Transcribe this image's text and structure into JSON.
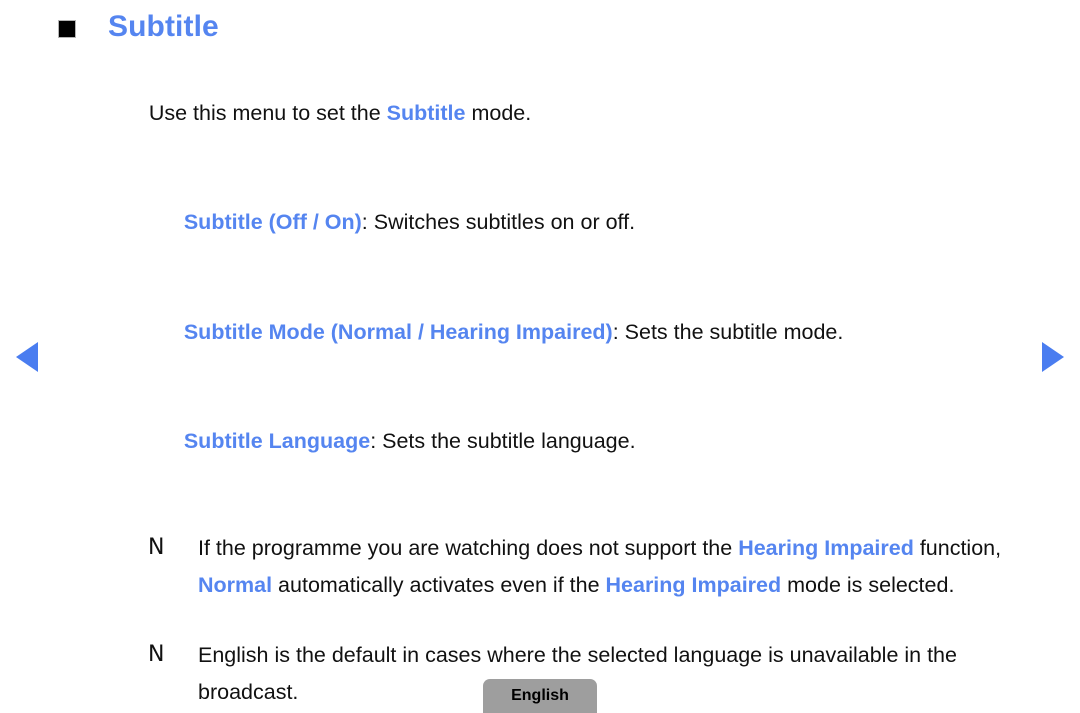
{
  "page": {
    "title": "Subtitle",
    "accent_color": "#5585f0",
    "arrow_color": "#4a7df0",
    "bullet_color": "#000000",
    "background_color": "#ffffff"
  },
  "header": {
    "bullet_icon": "filled-square-bullet-icon",
    "title": "Subtitle"
  },
  "body": {
    "intro": {
      "before": "Use this menu to set the ",
      "accent": "Subtitle",
      "after": " mode."
    },
    "options": [
      {
        "accent": "Subtitle (Off / On)",
        "rest": ": Switches subtitles on or off."
      },
      {
        "accent": "Subtitle Mode (Normal / Hearing Impaired)",
        "rest": ": Sets the subtitle mode."
      },
      {
        "accent": "Subtitle Language",
        "rest": ": Sets the subtitle language."
      }
    ],
    "notes": [
      {
        "marker": "N",
        "segments": [
          {
            "text": "If the programme you are watching does not support the ",
            "accent": false
          },
          {
            "text": "Hearing Impaired",
            "accent": true
          },
          {
            "text": " function, ",
            "accent": false
          },
          {
            "text": "Normal",
            "accent": true
          },
          {
            "text": " automatically activates even if the ",
            "accent": false
          },
          {
            "text": "Hearing Impaired",
            "accent": true
          },
          {
            "text": " mode is selected.",
            "accent": false
          }
        ]
      },
      {
        "marker": "N",
        "segments": [
          {
            "text": "English is the default in cases where the selected language is unavailable in the broadcast.",
            "accent": false
          }
        ]
      }
    ]
  },
  "navigation": {
    "previous_icon": "triangle-left-icon",
    "next_icon": "triangle-right-icon",
    "previous_label": "",
    "next_label": ""
  },
  "footer": {
    "language_button_label": "English"
  }
}
